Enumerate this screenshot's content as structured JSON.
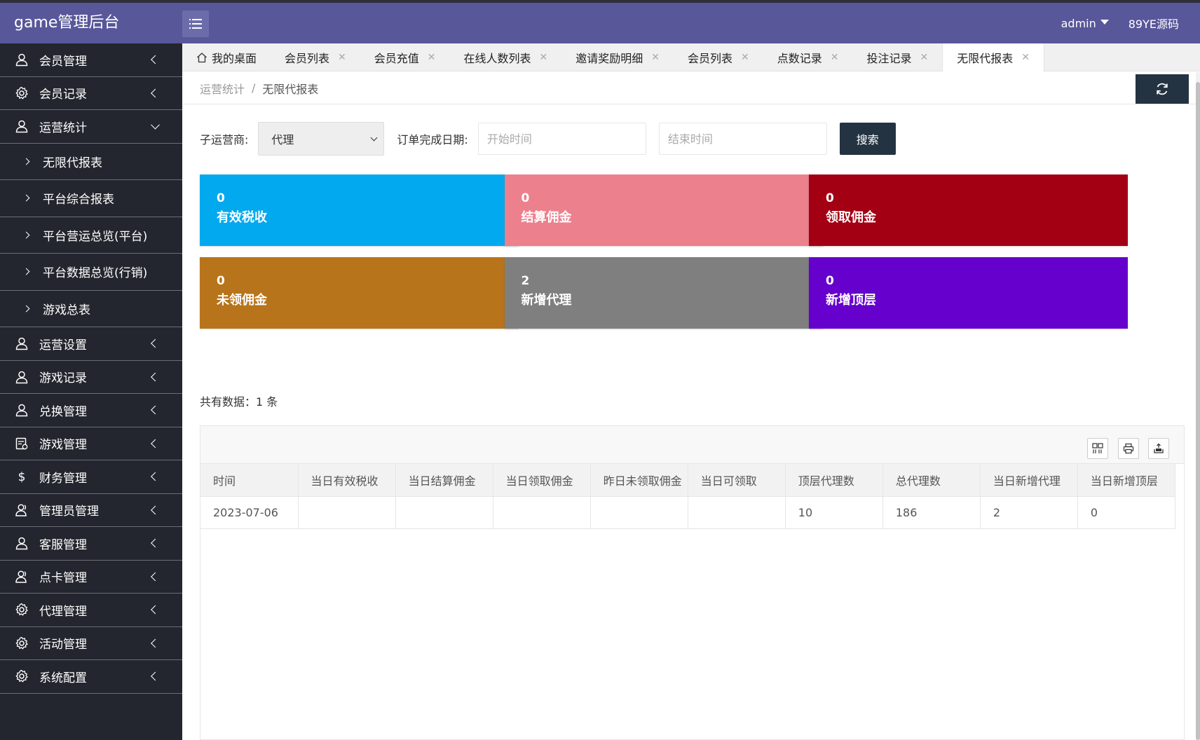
{
  "app": {
    "title": "game管理后台"
  },
  "header": {
    "user": "admin",
    "site_link": "89YE源码"
  },
  "sidebar": {
    "groups": [
      {
        "label": "会员管理",
        "icon": "user-icon"
      },
      {
        "label": "会员记录",
        "icon": "gear-icon"
      },
      {
        "label": "运营统计",
        "icon": "user-icon",
        "expanded": true,
        "children": [
          "无限代报表",
          "平台综合报表",
          "平台营运总览(平台)",
          "平台数据总览(行销)",
          "游戏总表"
        ]
      },
      {
        "label": "运营设置",
        "icon": "user-icon"
      },
      {
        "label": "游戏记录",
        "icon": "user-icon"
      },
      {
        "label": "兑换管理",
        "icon": "user-icon"
      },
      {
        "label": "游戏管理",
        "icon": "calendar-icon"
      },
      {
        "label": "财务管理",
        "icon": "dollar-icon"
      },
      {
        "label": "管理员管理",
        "icon": "users-icon"
      },
      {
        "label": "客服管理",
        "icon": "user-icon"
      },
      {
        "label": "点卡管理",
        "icon": "users-icon"
      },
      {
        "label": "代理管理",
        "icon": "gear-icon"
      },
      {
        "label": "活动管理",
        "icon": "gear-icon"
      },
      {
        "label": "系统配置",
        "icon": "gear-icon"
      }
    ]
  },
  "tabs": [
    {
      "label": "我的桌面",
      "closable": false,
      "home": true
    },
    {
      "label": "会员列表",
      "closable": true
    },
    {
      "label": "会员充值",
      "closable": true
    },
    {
      "label": "在线人数列表",
      "closable": true
    },
    {
      "label": "邀请奖励明细",
      "closable": true
    },
    {
      "label": "会员列表",
      "closable": true
    },
    {
      "label": "点数记录",
      "closable": true
    },
    {
      "label": "投注记录",
      "closable": true
    },
    {
      "label": "无限代报表",
      "closable": true,
      "active": true
    }
  ],
  "breadcrumb": {
    "parent": "运营统计",
    "separator": "/",
    "current": "无限代报表"
  },
  "filter": {
    "operator_label": "子运营商:",
    "operator_value": "代理",
    "date_label": "订单完成日期:",
    "start_placeholder": "开始时间",
    "end_placeholder": "结束时间",
    "search_label": "搜索"
  },
  "cards": [
    {
      "value": "0",
      "label": "有效税收",
      "color": "#03a9ef"
    },
    {
      "value": "0",
      "label": "结算佣金",
      "color": "#ec808d"
    },
    {
      "value": "0",
      "label": "领取佣金",
      "color": "#a30014"
    },
    {
      "value": "0",
      "label": "未领佣金",
      "color": "#b8741a"
    },
    {
      "value": "2",
      "label": "新增代理",
      "color": "#7f7f7f"
    },
    {
      "value": "0",
      "label": "新增顶层",
      "color": "#6600cc"
    }
  ],
  "summary": {
    "total_text": "共有数据：1 条"
  },
  "table": {
    "columns": [
      "时间",
      "当日有效税收",
      "当日结算佣金",
      "当日领取佣金",
      "昨日未领取佣金",
      "当日可领取",
      "顶层代理数",
      "总代理数",
      "当日新增代理",
      "当日新增顶层"
    ],
    "rows": [
      [
        "2023-07-06",
        "",
        "",
        "",
        "",
        "",
        "10",
        "186",
        "2",
        "0"
      ]
    ]
  },
  "colors": {
    "header": "#58579a",
    "sidebar": "#23262e",
    "dark_button": "#243341"
  }
}
